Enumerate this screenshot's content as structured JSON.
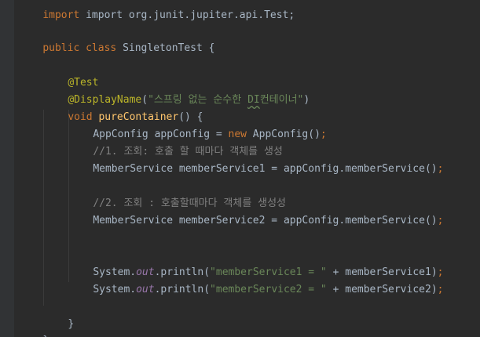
{
  "code": {
    "import_partial": "import org.junit.jupiter.api.Test;",
    "class_kw_public": "public",
    "class_kw_class": "class",
    "class_name": "SingletonTest",
    "open_brace": " {",
    "ann_test": "@Test",
    "ann_display": "@DisplayName",
    "ann_display_open": "(",
    "ann_display_str_a": "\"스프링 없는 순수한 ",
    "ann_display_str_b": "DI",
    "ann_display_str_c": "컨테이너\"",
    "ann_display_close": ")",
    "method_kw": "void",
    "method_name": "pureContainer",
    "method_sig_rest": "() {",
    "l_appconfig_a": "AppConfig appConfig = ",
    "l_appconfig_new": "new",
    "l_appconfig_b": " AppConfig()",
    "semi": ";",
    "comment1": "//1. 조회: 호출 할 때마다 객체를 생성",
    "l_ms1": "MemberService memberService1 = appConfig.memberService()",
    "comment2": "//2. 조회 : 호출할때마다 객체를 생성성",
    "l_ms2": "MemberService memberService2 = appConfig.memberService()",
    "sys": "System.",
    "out": "out",
    "println_open": ".println(",
    "str1": "\"memberService1 = \"",
    "concat1": " + memberService1)",
    "str2": "\"memberService2 = \"",
    "concat2": " + memberService2)",
    "close_inner": "}",
    "close_outer": "}"
  },
  "colors": {
    "background": "#2b2b2b",
    "keyword": "#cc7832",
    "annotation": "#bbb529",
    "string": "#6a8759",
    "comment": "#808080",
    "method": "#ffc66d",
    "static_field": "#9876aa",
    "text": "#a9b7c6"
  }
}
